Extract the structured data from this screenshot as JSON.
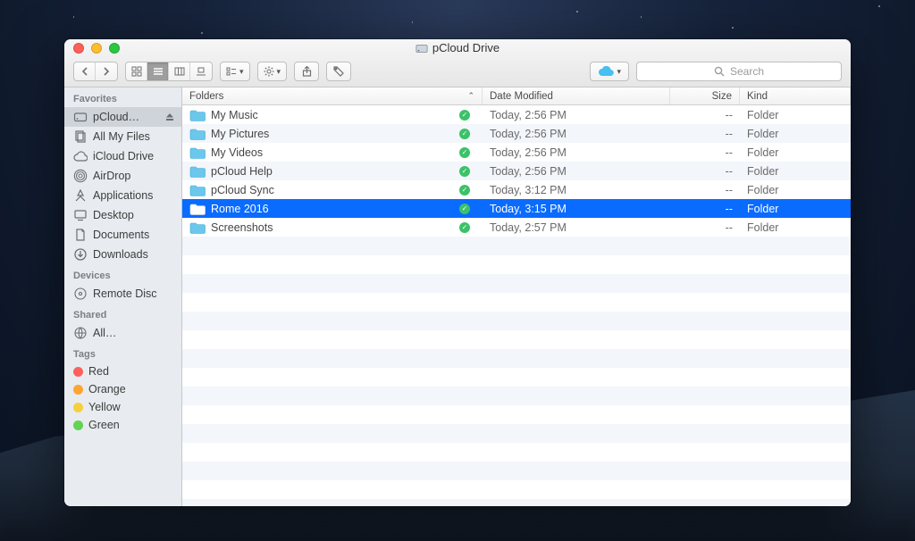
{
  "window": {
    "title": "pCloud Drive"
  },
  "search": {
    "placeholder": "Search"
  },
  "sidebar": {
    "sections": [
      {
        "title": "Favorites",
        "items": [
          {
            "label": "pCloud…",
            "icon": "drive",
            "selected": true,
            "eject": true
          },
          {
            "label": "All My Files",
            "icon": "allfiles"
          },
          {
            "label": "iCloud Drive",
            "icon": "icloud"
          },
          {
            "label": "AirDrop",
            "icon": "airdrop"
          },
          {
            "label": "Applications",
            "icon": "apps"
          },
          {
            "label": "Desktop",
            "icon": "desktop"
          },
          {
            "label": "Documents",
            "icon": "docs"
          },
          {
            "label": "Downloads",
            "icon": "downloads"
          }
        ]
      },
      {
        "title": "Devices",
        "items": [
          {
            "label": "Remote Disc",
            "icon": "remotedisc"
          }
        ]
      },
      {
        "title": "Shared",
        "items": [
          {
            "label": "All…",
            "icon": "network"
          }
        ]
      },
      {
        "title": "Tags",
        "items": [
          {
            "label": "Red",
            "icon": "tag",
            "color": "#fc605c"
          },
          {
            "label": "Orange",
            "icon": "tag",
            "color": "#fda432"
          },
          {
            "label": "Yellow",
            "icon": "tag",
            "color": "#f6cf3f"
          },
          {
            "label": "Green",
            "icon": "tag",
            "color": "#63d351"
          }
        ]
      }
    ]
  },
  "columns": {
    "name": "Folders",
    "date": "Date Modified",
    "size": "Size",
    "kind": "Kind",
    "sort_asc": true
  },
  "rows": [
    {
      "name": "My Music",
      "date": "Today, 2:56 PM",
      "size": "--",
      "kind": "Folder",
      "synced": true,
      "selected": false
    },
    {
      "name": "My Pictures",
      "date": "Today, 2:56 PM",
      "size": "--",
      "kind": "Folder",
      "synced": true,
      "selected": false
    },
    {
      "name": "My Videos",
      "date": "Today, 2:56 PM",
      "size": "--",
      "kind": "Folder",
      "synced": true,
      "selected": false
    },
    {
      "name": "pCloud Help",
      "date": "Today, 2:56 PM",
      "size": "--",
      "kind": "Folder",
      "synced": true,
      "selected": false
    },
    {
      "name": "pCloud Sync",
      "date": "Today, 3:12 PM",
      "size": "--",
      "kind": "Folder",
      "synced": true,
      "selected": false
    },
    {
      "name": "Rome 2016",
      "date": "Today, 3:15 PM",
      "size": "--",
      "kind": "Folder",
      "synced": true,
      "selected": true
    },
    {
      "name": "Screenshots",
      "date": "Today, 2:57 PM",
      "size": "--",
      "kind": "Folder",
      "synced": true,
      "selected": false
    }
  ],
  "colors": {
    "folder": "#6cc7ec",
    "folder_sel": "#ffffff",
    "cloudbtn": "#47bff0"
  }
}
